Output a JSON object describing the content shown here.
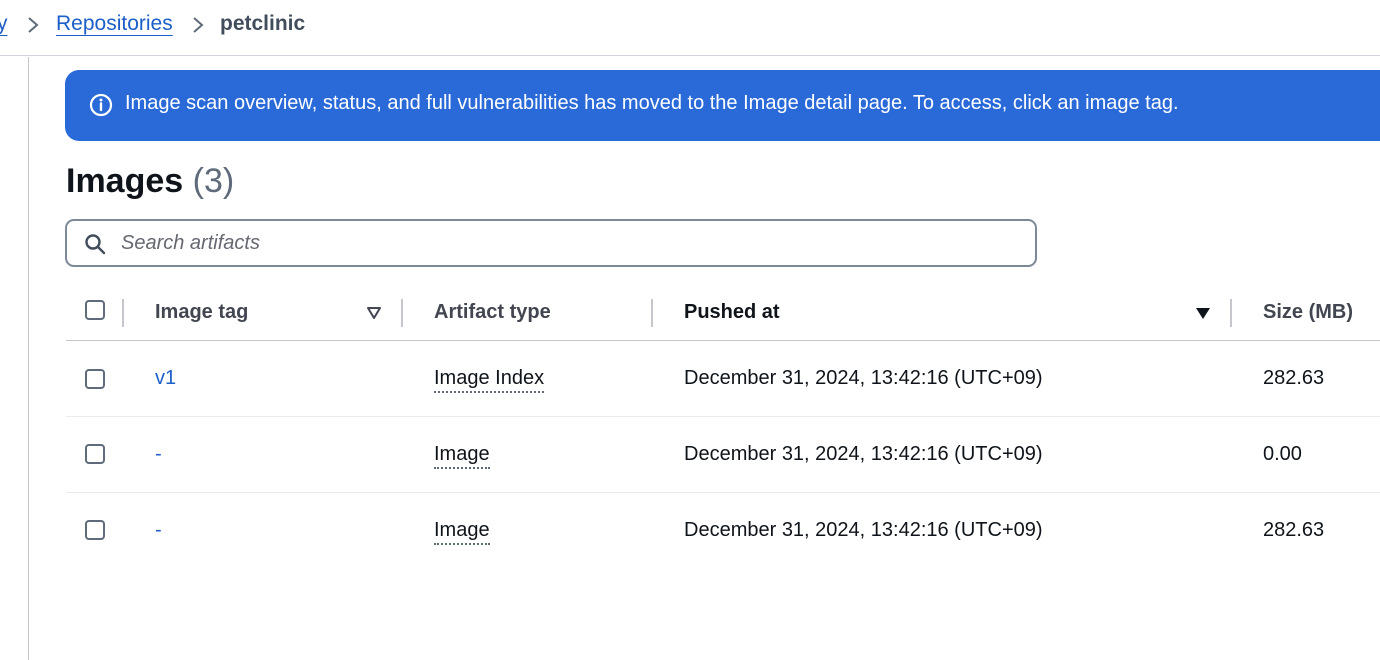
{
  "breadcrumb": {
    "partial_link": "y",
    "repositories_link": "Repositories",
    "current": "petclinic"
  },
  "banner": {
    "icon": "info-icon",
    "message": "Image scan overview, status, and full vulnerabilities has moved to the Image detail page. To access, click an image tag.",
    "background_color": "#2a6ad8"
  },
  "images_section": {
    "title": "Images",
    "count": "(3)"
  },
  "search": {
    "placeholder": "Search artifacts",
    "value": ""
  },
  "table": {
    "columns": {
      "image_tag": "Image tag",
      "artifact_type": "Artifact type",
      "pushed_at": "Pushed at",
      "size": "Size (MB)"
    },
    "rows": [
      {
        "tag": "v1",
        "artifact_type": "Image Index",
        "pushed_at": "December 31, 2024, 13:42:16 (UTC+09)",
        "size": "282.63"
      },
      {
        "tag": "-",
        "artifact_type": "Image",
        "pushed_at": "December 31, 2024, 13:42:16 (UTC+09)",
        "size": "0.00"
      },
      {
        "tag": "-",
        "artifact_type": "Image",
        "pushed_at": "December 31, 2024, 13:42:16 (UTC+09)",
        "size": "282.63"
      }
    ]
  },
  "colors": {
    "link": "#1d5fc9",
    "banner": "#2a6ad8"
  }
}
